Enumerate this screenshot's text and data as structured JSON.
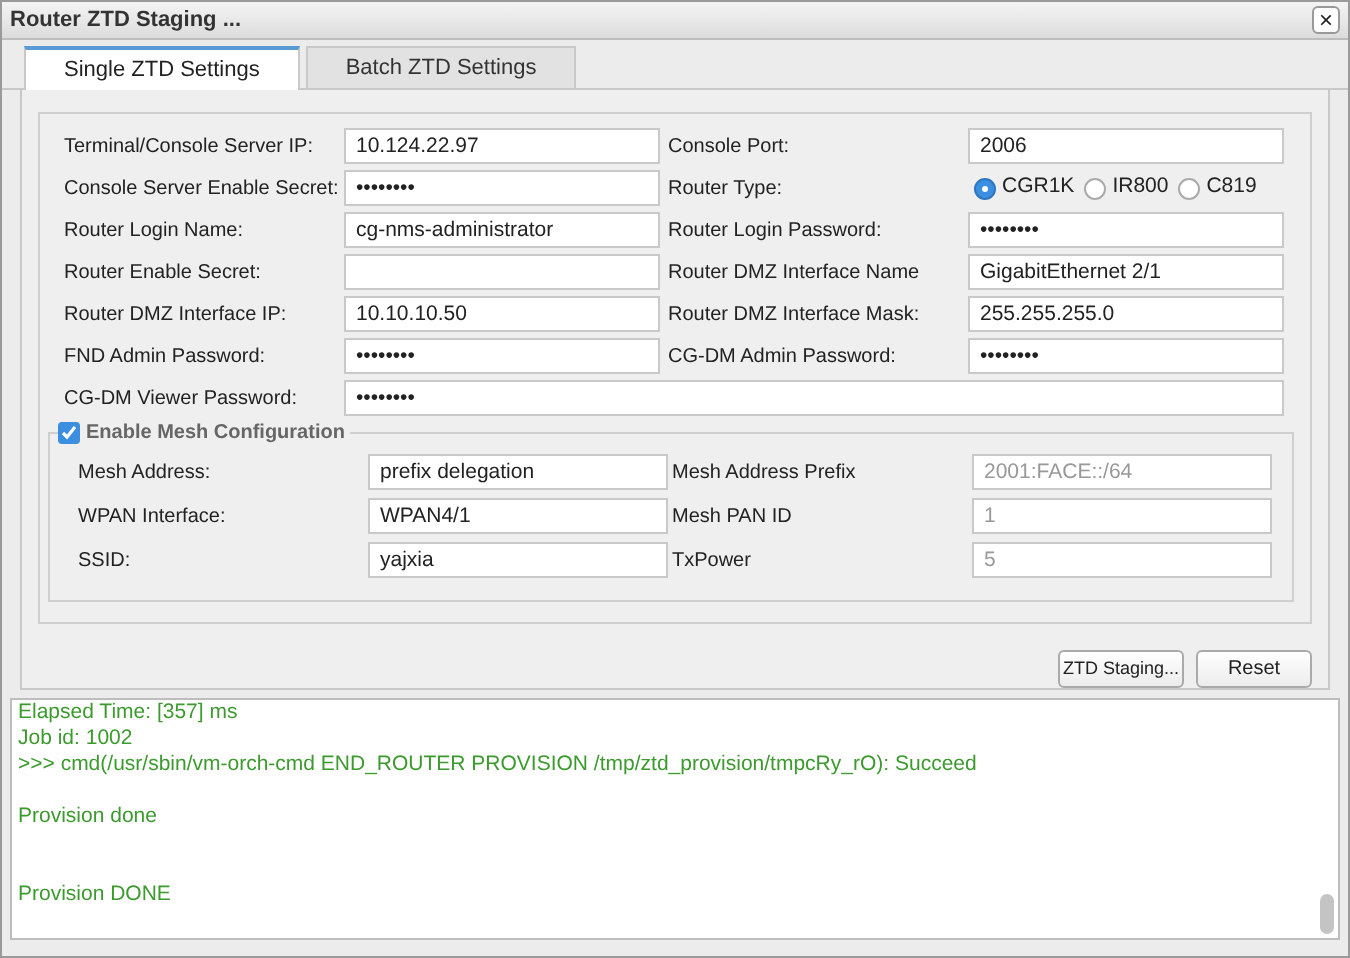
{
  "window": {
    "title": "Router ZTD Staging ...",
    "close": "×"
  },
  "tabs": [
    {
      "label": "Single ZTD Settings",
      "selected": true
    },
    {
      "label": "Batch ZTD Settings",
      "selected": false
    }
  ],
  "fields": [
    {
      "label": "Terminal/Console Server IP:",
      "kind": "text",
      "value": "10.124.22.97"
    },
    {
      "label": "Console Port:",
      "kind": "text",
      "value": "2006"
    },
    {
      "label": "Console Server Enable Secret:",
      "kind": "password",
      "value": "••••••••"
    },
    {
      "label": "Router Type:",
      "kind": "radio",
      "options": [
        {
          "label": "CGR1K",
          "selected": true
        },
        {
          "label": "IR800",
          "selected": false
        },
        {
          "label": "C819",
          "selected": false
        }
      ]
    },
    {
      "label": "Router Login Name:",
      "kind": "text",
      "value": "cg-nms-administrator"
    },
    {
      "label": "Router Login Password:",
      "kind": "password",
      "value": "••••••••"
    },
    {
      "label": "Router Enable Secret:",
      "kind": "text"
    },
    {
      "label": "Router DMZ Interface Name",
      "kind": "text",
      "value": "GigabitEthernet 2/1"
    },
    {
      "label": "Router DMZ Interface IP:",
      "kind": "text",
      "value": "10.10.10.50"
    },
    {
      "label": "Router DMZ Interface Mask:",
      "kind": "text",
      "value": "255.255.255.0"
    },
    {
      "label": "FND Admin Password:",
      "kind": "password",
      "value": "••••••••"
    },
    {
      "label": "CG-DM Admin Password:",
      "kind": "password",
      "value": "••••••••"
    }
  ],
  "wide_field": {
    "label": "CG-DM Viewer Password:",
    "kind": "password",
    "value": "••••••••"
  },
  "mesh": {
    "label": "Enable Mesh Configuration",
    "checked": true,
    "fields": [
      {
        "label": "Mesh Address:",
        "value": "prefix delegation",
        "disabled": false
      },
      {
        "label": "Mesh Address Prefix",
        "value": "2001:FACE::/64",
        "disabled": true
      },
      {
        "label": "WPAN Interface:",
        "value": "WPAN4/1",
        "disabled": false
      },
      {
        "label": "Mesh PAN ID",
        "value": "1",
        "disabled": true
      },
      {
        "label": "SSID:",
        "value": "yajxia",
        "disabled": false
      },
      {
        "label": "TxPower",
        "value": "5",
        "disabled": true
      }
    ]
  },
  "buttons": [
    "ZTD Staging...",
    "Reset"
  ],
  "log_blocks": [
    [
      "Elapsed Time: [357] ms",
      "Job id: 1002",
      ">>> cmd(/usr/sbin/vm-orch-cmd END_ROUTER PROVISION /tmp/ztd_provision/tmpcRy_rO): Succeed"
    ],
    [
      "Provision done"
    ],
    [
      "Provision DONE"
    ]
  ]
}
